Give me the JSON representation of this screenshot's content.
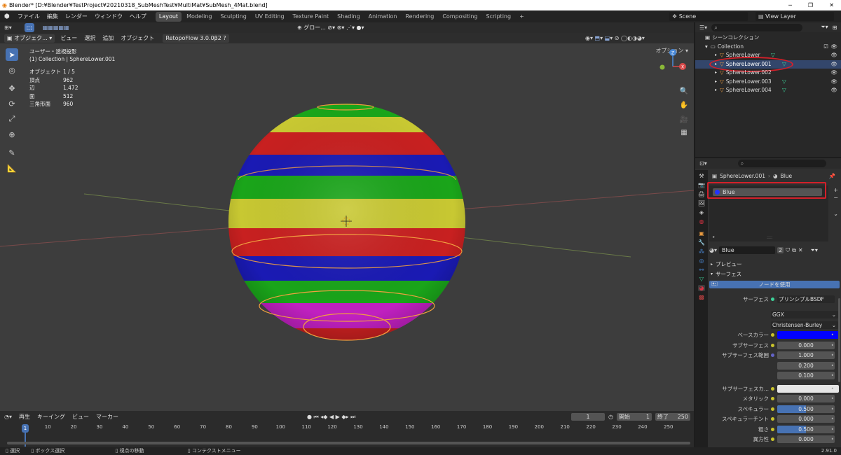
{
  "title": "Blender* [D:¥Blender¥TestProject¥20210318_SubMeshTest¥MultiMat¥SubMesh_4Mat.blend]",
  "menu": [
    "ファイル",
    "編集",
    "レンダー",
    "ウィンドウ",
    "ヘルプ"
  ],
  "workspaces": [
    "Layout",
    "Modeling",
    "Sculpting",
    "UV Editing",
    "Texture Paint",
    "Shading",
    "Animation",
    "Rendering",
    "Compositing",
    "Scripting"
  ],
  "scene": "Scene",
  "view_layer": "View Layer",
  "vp": {
    "mode": "オブジェク...",
    "menus": [
      "ビュー",
      "選択",
      "追加",
      "オブジェクト"
    ],
    "addon": "RetopoFlow 3.0.0β2",
    "orient": "グロー...",
    "options": "オプション",
    "ov_title": "ユーザー・透視投影",
    "ov_sub": "(1) Collection | SphereLower.001",
    "stats": [
      [
        "オブジェクト",
        "1 / 5"
      ],
      [
        "頂点",
        "962"
      ],
      [
        "辺",
        "1,472"
      ],
      [
        "面",
        "512"
      ],
      [
        "三角形面",
        "960"
      ]
    ]
  },
  "outliner": {
    "root": "シーンコレクション",
    "collection": "Collection",
    "items": [
      "SphereLower",
      "SphereLower.001",
      "SphereLower.002",
      "SphereLower.003",
      "SphereLower.004"
    ]
  },
  "props": {
    "obj": "SphereLower.001",
    "mat": "Blue",
    "slot": "Blue",
    "datablock": "Blue",
    "users": "2",
    "preview": "プレビュー",
    "surface_panel": "サーフェス",
    "use_nodes": "ノードを使用",
    "surface_label": "サーフェス",
    "surface_val": "プリンシプルBSDF",
    "dist": "GGX",
    "sss_method": "Christensen-Burley",
    "rows": [
      {
        "label": "ベースカラー",
        "color": "#0000ff"
      },
      {
        "label": "サブサーフェス",
        "value": "0.000"
      },
      {
        "label": "サブサーフェス範囲",
        "value": "1.000"
      },
      {
        "label": "",
        "value": "0.200"
      },
      {
        "label": "",
        "value": "0.100"
      },
      {
        "label": "サブサーフェスカ...",
        "color": "#e6e6e6"
      },
      {
        "label": "メタリック",
        "value": "0.000"
      },
      {
        "label": "スペキュラー",
        "value": "0.500",
        "fill": 0.5
      },
      {
        "label": "スペキュラーチント",
        "value": "0.000"
      },
      {
        "label": "粗さ",
        "value": "0.500",
        "fill": 0.5
      },
      {
        "label": "異方性",
        "value": "0.000"
      }
    ]
  },
  "timeline": {
    "menus": [
      "再生",
      "キーイング",
      "ビュー",
      "マーカー"
    ],
    "frame": "1",
    "start_label": "開始",
    "start": "1",
    "end_label": "終了",
    "end": "250",
    "ticks": [
      "1",
      "10",
      "20",
      "30",
      "40",
      "50",
      "60",
      "70",
      "80",
      "90",
      "100",
      "110",
      "120",
      "130",
      "140",
      "150",
      "160",
      "170",
      "180",
      "190",
      "200",
      "210",
      "220",
      "230",
      "240",
      "250"
    ]
  },
  "status": {
    "select": "選択",
    "box": "ボックス選択",
    "rotate": "視点の移動",
    "context": "コンテクストメニュー",
    "version": "2.91.0"
  },
  "colors": {
    "accent": "#4772b3",
    "selection": "#33466b",
    "highlight_box": "#d4202a"
  }
}
